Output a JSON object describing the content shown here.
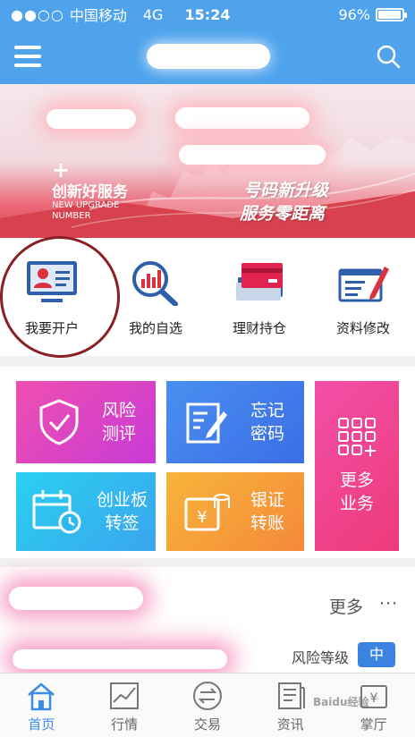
{
  "status_bar": {
    "signal": "●●○○",
    "carrier": "中国移动",
    "network": "4G",
    "time": "15:24",
    "battery_percent": "96%",
    "battery_level": 0.96
  },
  "banner": {
    "plus": "+",
    "service_cn": "创新好服务",
    "service_en": "NEW UPGRADE NUMBER",
    "slogan_line1": "号码新升级",
    "slogan_line2": "服务零距离"
  },
  "quick_actions": [
    {
      "label": "我要开户",
      "icon": "id-card-icon"
    },
    {
      "label": "我的自选",
      "icon": "chart-search-icon"
    },
    {
      "label": "理财持仓",
      "icon": "cards-icon"
    },
    {
      "label": "资料修改",
      "icon": "edit-form-icon"
    }
  ],
  "tiles": [
    {
      "label_line1": "风险",
      "label_line2": "测评",
      "color_from": "#f04fb0",
      "color_to": "#c73bd6"
    },
    {
      "label_line1": "忘记",
      "label_line2": "密码",
      "color_from": "#4a8ff0",
      "color_to": "#3b6ee6"
    },
    {
      "label_line1": "更多",
      "label_line2": "业务",
      "color_from": "#f24fa8",
      "color_to": "#ee3b7a"
    },
    {
      "label_line1": "创业板",
      "label_line2": "转签",
      "color_from": "#2ad0f0",
      "color_to": "#3aa5ee"
    },
    {
      "label_line1": "银证",
      "label_line2": "转账",
      "color_from": "#f7b43a",
      "color_to": "#f5893a"
    }
  ],
  "info": {
    "more_label": "更多",
    "more_dots": "···",
    "risk_label": "风险等级",
    "risk_value": "中"
  },
  "tabbar": [
    {
      "label": "首页",
      "icon": "home-icon",
      "active": true
    },
    {
      "label": "行情",
      "icon": "market-chart-icon",
      "active": false
    },
    {
      "label": "交易",
      "icon": "trade-arrows-icon",
      "active": false
    },
    {
      "label": "资讯",
      "icon": "news-icon",
      "active": false
    },
    {
      "label": "掌厅",
      "icon": "wallet-icon",
      "active": false
    }
  ],
  "watermark": "Baidu经验",
  "colors": {
    "header": "#4ea3ec",
    "accent_blue": "#3c8be6",
    "annotation_circle": "#8a1f25"
  }
}
